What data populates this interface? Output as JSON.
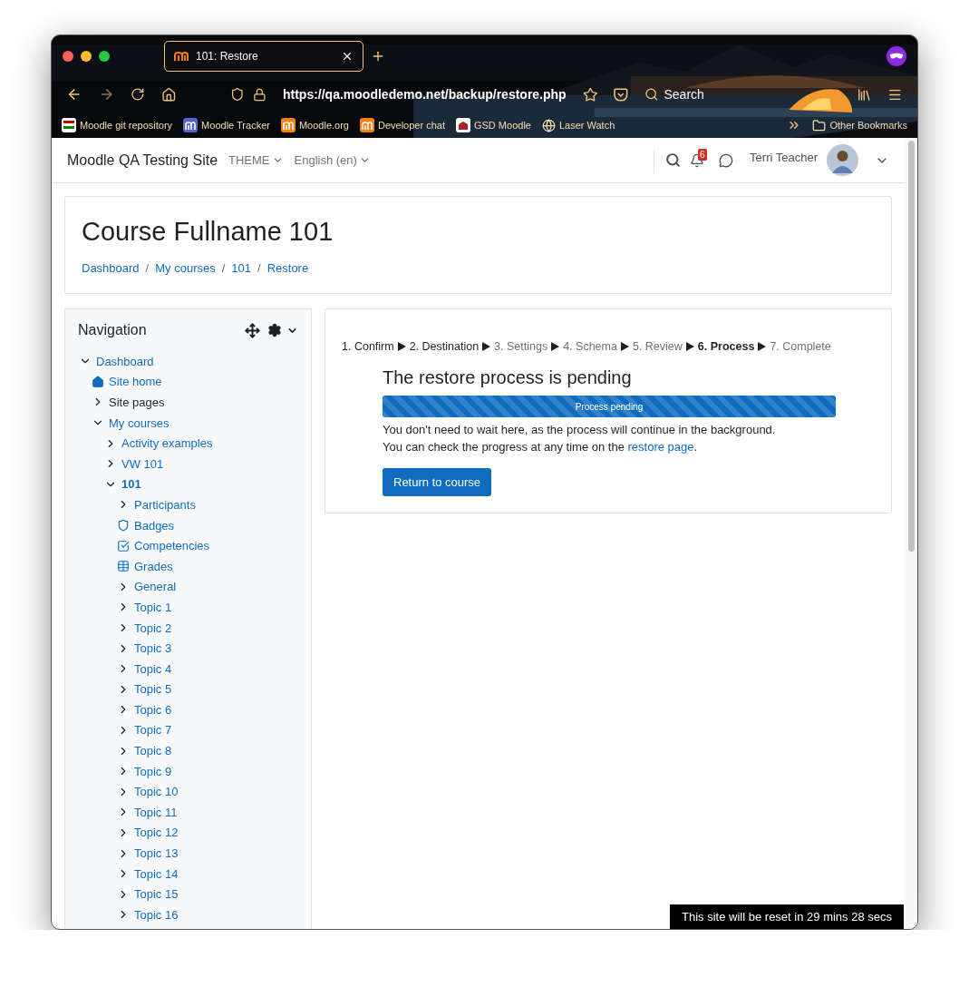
{
  "browser": {
    "tab": {
      "title": "101: Restore",
      "selected": true
    },
    "url": "https://qa.moodledemo.net/backup/restore.php",
    "search": {
      "placeholder": "Search"
    },
    "bookmarks": [
      {
        "label": "Moodle git repository"
      },
      {
        "label": "Moodle Tracker"
      },
      {
        "label": "Moodle.org"
      },
      {
        "label": "Developer chat"
      },
      {
        "label": "GSD Moodle"
      },
      {
        "label": "Laser Watch"
      }
    ],
    "other_bookmarks": "Other Bookmarks"
  },
  "header": {
    "site_name": "Moodle QA Testing Site",
    "menus": [
      "THEME",
      "English (en)"
    ],
    "notification_count": "6",
    "user_name": "Terri Teacher"
  },
  "course": {
    "title": "Course Fullname 101",
    "breadcrumbs": [
      {
        "label": "Dashboard"
      },
      {
        "separator": "/",
        "label": "My courses"
      },
      {
        "separator": "/",
        "label": "101"
      },
      {
        "separator": "/",
        "label": "Restore"
      }
    ]
  },
  "navigation": {
    "title": "Navigation",
    "items": [
      {
        "label": "Dashboard",
        "kind": "branch",
        "expanded": true,
        "link": true,
        "current": false,
        "children": [
          {
            "label": "Site home",
            "kind": "home",
            "link": true,
            "current": false
          },
          {
            "label": "Site pages",
            "kind": "branch",
            "expanded": false,
            "link": false,
            "current": false
          },
          {
            "label": "My courses",
            "kind": "branch",
            "expanded": true,
            "link": true,
            "current": false,
            "children": [
              {
                "label": "Activity examples",
                "kind": "branch",
                "expanded": false,
                "link": true,
                "current": false
              },
              {
                "label": "VW 101",
                "kind": "branch",
                "expanded": false,
                "link": true,
                "current": false
              },
              {
                "label": "101",
                "kind": "branch",
                "expanded": true,
                "link": true,
                "current": true,
                "children": [
                  {
                    "label": "Participants",
                    "kind": "branch",
                    "expanded": false,
                    "link": true,
                    "current": false
                  },
                  {
                    "label": "Badges",
                    "kind": "shield",
                    "link": true,
                    "current": false
                  },
                  {
                    "label": "Competencies",
                    "kind": "checkbox",
                    "link": true,
                    "current": false
                  },
                  {
                    "label": "Grades",
                    "kind": "table",
                    "link": true,
                    "current": false
                  },
                  {
                    "label": "General",
                    "kind": "branch",
                    "expanded": false,
                    "link": true,
                    "current": false
                  },
                  {
                    "label": "Topic 1",
                    "kind": "branch",
                    "expanded": false,
                    "link": true,
                    "current": false
                  },
                  {
                    "label": "Topic 2",
                    "kind": "branch",
                    "expanded": false,
                    "link": true,
                    "current": false
                  },
                  {
                    "label": "Topic 3",
                    "kind": "branch",
                    "expanded": false,
                    "link": true,
                    "current": false
                  },
                  {
                    "label": "Topic 4",
                    "kind": "branch",
                    "expanded": false,
                    "link": true,
                    "current": false
                  },
                  {
                    "label": "Topic 5",
                    "kind": "branch",
                    "expanded": false,
                    "link": true,
                    "current": false
                  },
                  {
                    "label": "Topic 6",
                    "kind": "branch",
                    "expanded": false,
                    "link": true,
                    "current": false
                  },
                  {
                    "label": "Topic 7",
                    "kind": "branch",
                    "expanded": false,
                    "link": true,
                    "current": false
                  },
                  {
                    "label": "Topic 8",
                    "kind": "branch",
                    "expanded": false,
                    "link": true,
                    "current": false
                  },
                  {
                    "label": "Topic 9",
                    "kind": "branch",
                    "expanded": false,
                    "link": true,
                    "current": false
                  },
                  {
                    "label": "Topic 10",
                    "kind": "branch",
                    "expanded": false,
                    "link": true,
                    "current": false
                  },
                  {
                    "label": "Topic 11",
                    "kind": "branch",
                    "expanded": false,
                    "link": true,
                    "current": false
                  },
                  {
                    "label": "Topic 12",
                    "kind": "branch",
                    "expanded": false,
                    "link": true,
                    "current": false
                  },
                  {
                    "label": "Topic 13",
                    "kind": "branch",
                    "expanded": false,
                    "link": true,
                    "current": false
                  },
                  {
                    "label": "Topic 14",
                    "kind": "branch",
                    "expanded": false,
                    "link": true,
                    "current": false
                  },
                  {
                    "label": "Topic 15",
                    "kind": "branch",
                    "expanded": false,
                    "link": true,
                    "current": false
                  },
                  {
                    "label": "Topic 16",
                    "kind": "branch",
                    "expanded": false,
                    "link": true,
                    "current": false
                  }
                ]
              }
            ]
          }
        ]
      }
    ]
  },
  "restore": {
    "steps": [
      {
        "label": "1. Confirm",
        "done": true,
        "current": false
      },
      {
        "label": "2. Destination",
        "done": true,
        "current": false
      },
      {
        "label": "3. Settings",
        "done": false,
        "current": false
      },
      {
        "label": "4. Schema",
        "done": false,
        "current": false
      },
      {
        "label": "5. Review",
        "done": false,
        "current": false
      },
      {
        "label": "6. Process",
        "done": false,
        "current": true
      },
      {
        "label": "7. Complete",
        "done": false,
        "current": false
      }
    ],
    "heading": "The restore process is pending",
    "progress": {
      "label": "Process pending",
      "level": 1
    },
    "message": "You don't need to wait here, as the process will continue in the background.",
    "check_text": "You can check the progress at any time on the",
    "check_link": "restore page",
    "check_end": ".",
    "button": "Return to course"
  },
  "reset_notice": "This site will be reset in 29 mins 28 secs"
}
